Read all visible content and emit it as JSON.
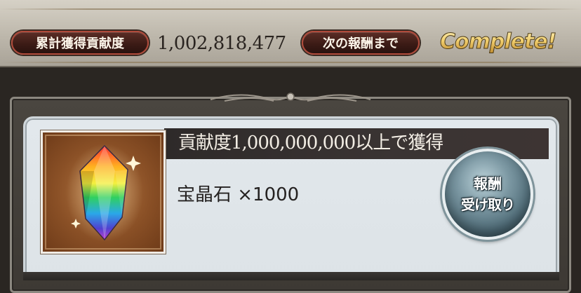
{
  "status_bar": {
    "total_contribution_label": "累計獲得貢献度",
    "total_contribution_value": "1,002,818,477",
    "next_reward_label": "次の報酬まで",
    "next_reward_value": "Complete!"
  },
  "reward": {
    "condition": "貢献度1,000,000,000以上で獲得",
    "item_name": "宝晶石 ×1000",
    "item_icon": "rainbow-crystal-icon",
    "claim_button": {
      "line1": "報酬",
      "line2": "受け取り"
    }
  },
  "colors": {
    "pill_border": "#b04a3a",
    "complete_gold": "#f1cf6e",
    "card_bg": "#e2e8ec",
    "header_bg": "#2e2a29",
    "button_blue": "#4d6a76"
  }
}
